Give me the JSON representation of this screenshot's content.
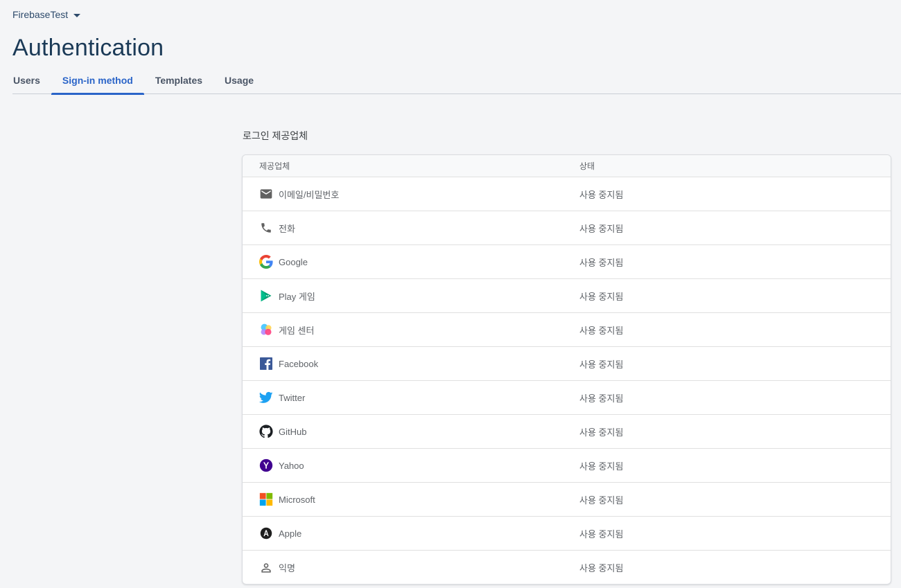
{
  "project": {
    "name": "FirebaseTest"
  },
  "page": {
    "title": "Authentication"
  },
  "tabs": [
    {
      "label": "Users"
    },
    {
      "label": "Sign-in method"
    },
    {
      "label": "Templates"
    },
    {
      "label": "Usage"
    }
  ],
  "active_tab": "Sign-in method",
  "section": {
    "title": "로그인 제공업체"
  },
  "table": {
    "headers": {
      "provider": "제공업체",
      "status": "상태"
    },
    "rows": [
      {
        "icon": "email-icon",
        "name": "이메일/비밀번호",
        "status": "사용 중지됨"
      },
      {
        "icon": "phone-icon",
        "name": "전화",
        "status": "사용 중지됨"
      },
      {
        "icon": "google-icon",
        "name": "Google",
        "status": "사용 중지됨"
      },
      {
        "icon": "play-games-icon",
        "name": "Play 게임",
        "status": "사용 중지됨"
      },
      {
        "icon": "game-center-icon",
        "name": "게임 센터",
        "status": "사용 중지됨"
      },
      {
        "icon": "facebook-icon",
        "name": "Facebook",
        "status": "사용 중지됨"
      },
      {
        "icon": "twitter-icon",
        "name": "Twitter",
        "status": "사용 중지됨"
      },
      {
        "icon": "github-icon",
        "name": "GitHub",
        "status": "사용 중지됨"
      },
      {
        "icon": "yahoo-icon",
        "name": "Yahoo",
        "status": "사용 중지됨"
      },
      {
        "icon": "microsoft-icon",
        "name": "Microsoft",
        "status": "사용 중지됨"
      },
      {
        "icon": "apple-icon",
        "name": "Apple",
        "status": "사용 중지됨"
      },
      {
        "icon": "anonymous-icon",
        "name": "익명",
        "status": "사용 중지됨"
      }
    ]
  },
  "colors": {
    "accent": "#2a64c8",
    "background": "#f4f5f7",
    "title": "#1b3a57"
  }
}
